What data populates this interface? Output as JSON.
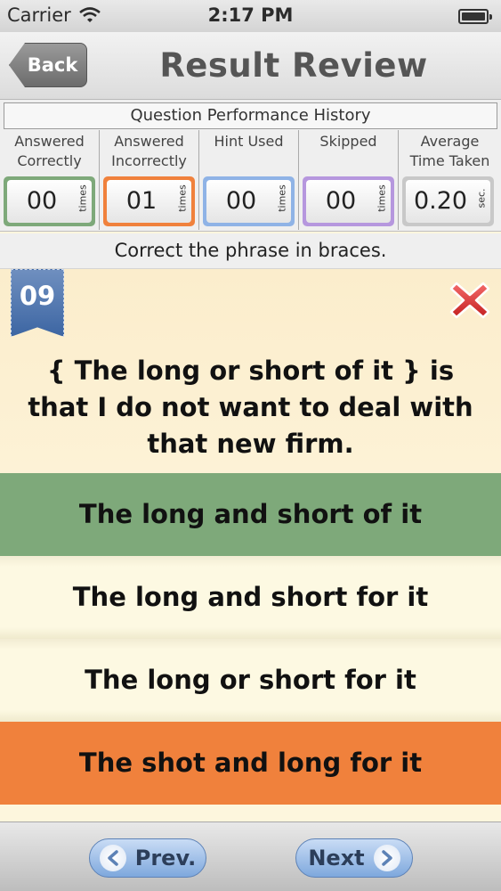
{
  "status_bar": {
    "carrier": "Carrier",
    "time": "2:17 PM"
  },
  "nav": {
    "back_label": "Back",
    "title": "Result Review"
  },
  "stats": {
    "header": "Question Performance History",
    "columns": [
      {
        "label_line1": "Answered",
        "label_line2": "Correctly",
        "value": "00",
        "unit": "times",
        "color": "#7ea97a"
      },
      {
        "label_line1": "Answered",
        "label_line2": "Incorrectly",
        "value": "01",
        "unit": "times",
        "color": "#f0813c"
      },
      {
        "label_line1": "Hint Used",
        "label_line2": "",
        "value": "00",
        "unit": "times",
        "color": "#8fb3e6"
      },
      {
        "label_line1": "Skipped",
        "label_line2": "",
        "value": "00",
        "unit": "times",
        "color": "#b697de"
      },
      {
        "label_line1": "Average",
        "label_line2": "Time Taken",
        "value": "0.20",
        "unit": "sec.",
        "color": "#c8c8c8"
      }
    ]
  },
  "instruction": "Correct the phrase in braces.",
  "question": {
    "number": "09",
    "text": "{ The long or short of it } is that I do not want to deal with that new firm."
  },
  "answers": [
    {
      "text": "The long and short of it",
      "state": "correct"
    },
    {
      "text": "The long and short for it",
      "state": "neutral"
    },
    {
      "text": "The long or short for it",
      "state": "neutral"
    },
    {
      "text": "The shot and long for it",
      "state": "wrong"
    }
  ],
  "footer": {
    "prev_label": "Prev.",
    "next_label": "Next"
  }
}
